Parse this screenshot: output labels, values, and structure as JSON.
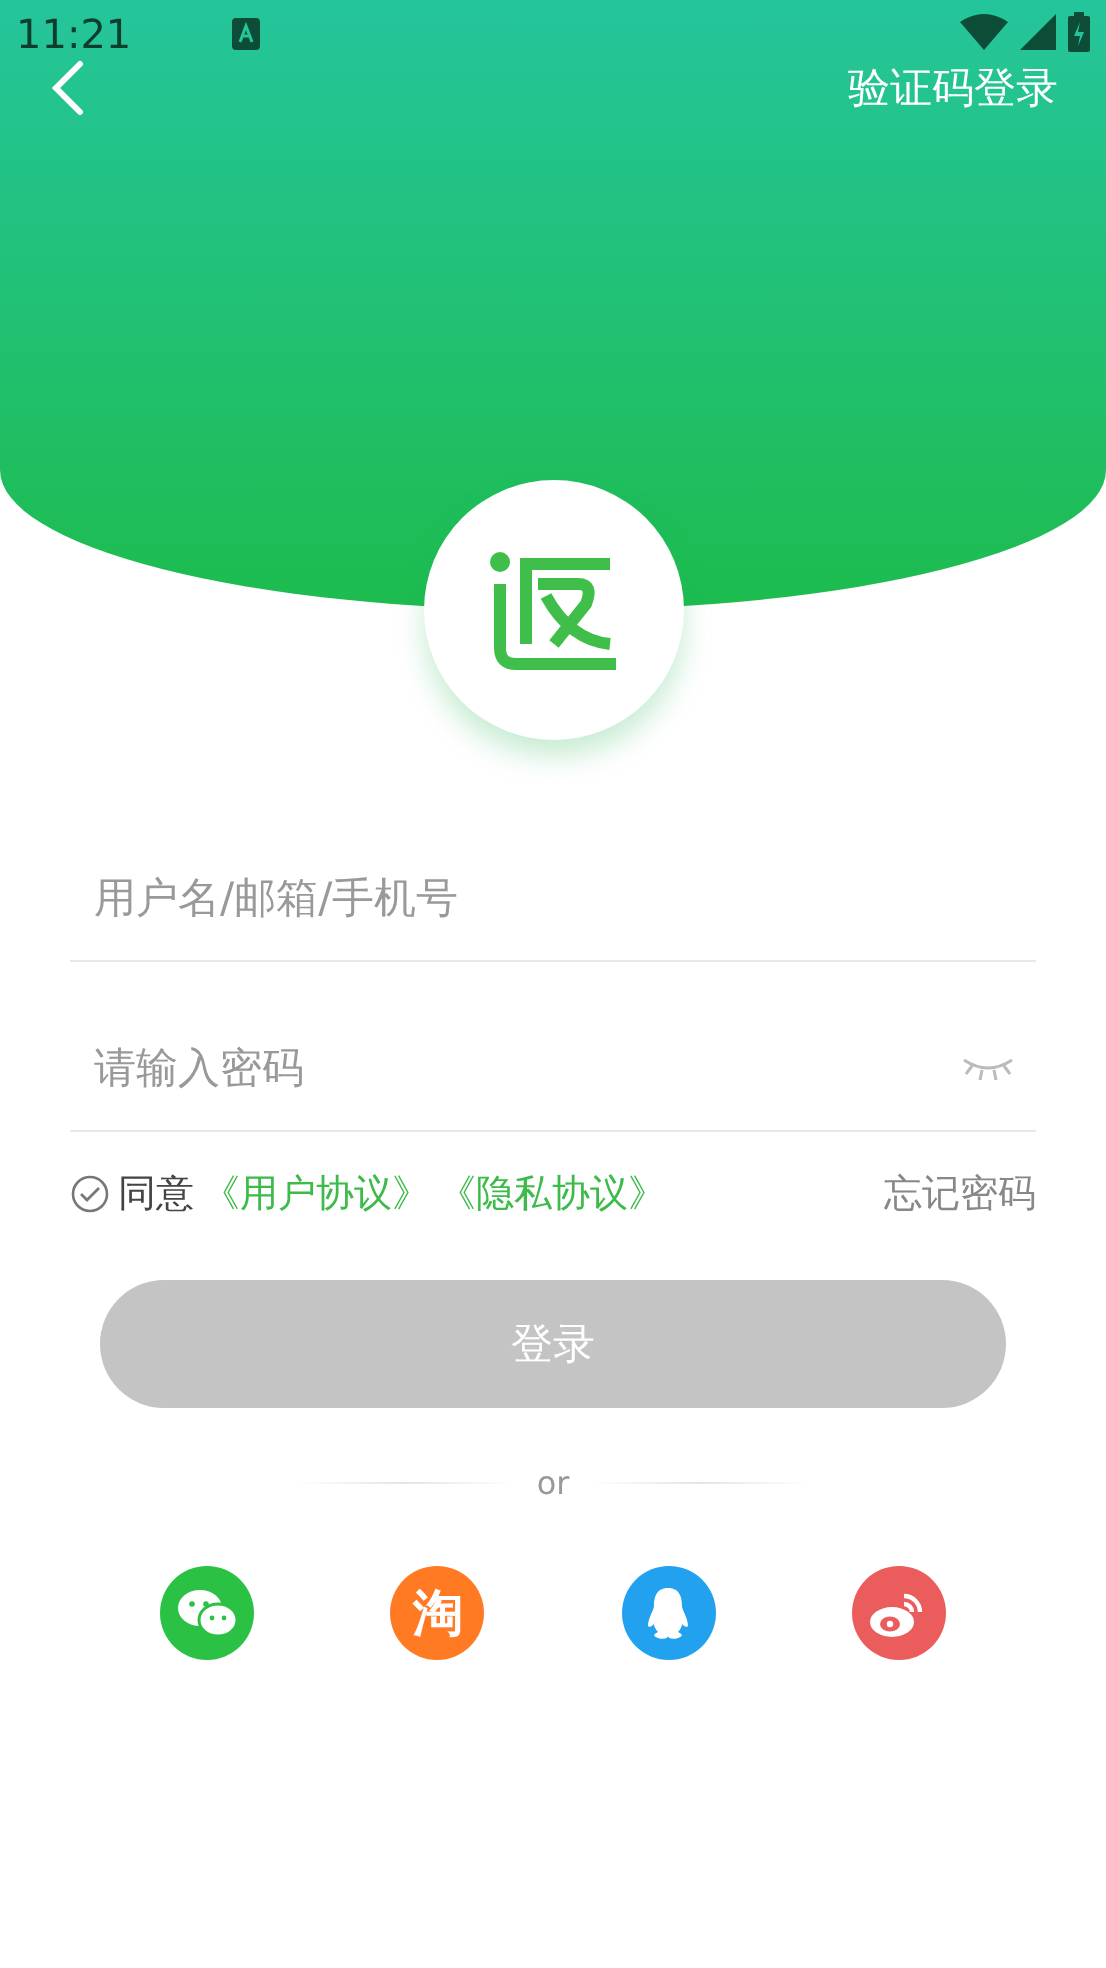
{
  "status_bar": {
    "time": "11:21"
  },
  "header": {
    "action": "验证码登录"
  },
  "form": {
    "username": {
      "placeholder": "用户名/邮箱/手机号"
    },
    "password": {
      "placeholder": "请输入密码",
      "visible": false
    }
  },
  "agreement": {
    "checked": false,
    "prefix": "同意",
    "links": [
      "《用户协议》",
      "《隐私协议》"
    ],
    "forgot": "忘记密码"
  },
  "login_button": {
    "label": "登录",
    "disabled": true
  },
  "divider": "or",
  "social": [
    {
      "kind": "wechat",
      "color": "#2bc144"
    },
    {
      "kind": "taobao",
      "color": "#ff7a22",
      "label": "淘"
    },
    {
      "kind": "qq",
      "color": "#22a2ee"
    },
    {
      "kind": "weibo",
      "color": "#ea5d5c"
    }
  ]
}
